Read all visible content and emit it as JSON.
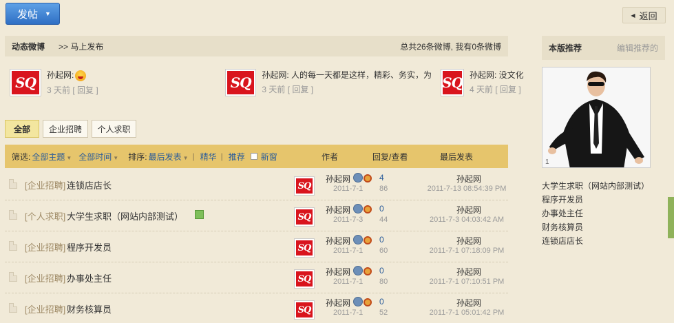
{
  "toolbar": {
    "post_label": "发帖",
    "back_label": "返回"
  },
  "weibo": {
    "title": "动态微博",
    "post_link": ">> 马上发布",
    "stats": "总共26条微博, 我有0条微博",
    "items": [
      {
        "text": "孙起网:",
        "meta_ago": "3 天前",
        "meta_reply": "[ 回复 ]"
      },
      {
        "text": "孙起网: 人的每一天都是这样，精彩、务实，为",
        "meta_ago": "3 天前",
        "meta_reply": "[ 回复 ]"
      },
      {
        "text": "孙起网: 没文化，真",
        "meta_ago": "4 天前",
        "meta_reply": "[ 回复 ]"
      }
    ],
    "logo_text": "SQ"
  },
  "filter_tabs": [
    {
      "label": "全部",
      "active": true
    },
    {
      "label": "企业招聘",
      "active": false
    },
    {
      "label": "个人求职",
      "active": false
    }
  ],
  "table_header": {
    "filter_label": "筛选:",
    "all_topics": "全部主题",
    "all_time": "全部时间",
    "sort_label": "排序:",
    "sort_value": "最后发表",
    "digest": "精华",
    "recommend": "推荐",
    "new_window": "新窗",
    "col_author": "作者",
    "col_replies": "回复/查看",
    "col_last": "最后发表"
  },
  "threads": [
    {
      "category": "[企业招聘]",
      "title": "连锁店店长",
      "has_image": false,
      "author": "孙起网",
      "date": "2011-7-1",
      "replies": "4",
      "views": "86",
      "last_user": "孙起网",
      "last_time": "2011-7-13 08:54:39 PM"
    },
    {
      "category": "[个人求职]",
      "title": "大学生求职（网站内部测试）",
      "has_image": true,
      "author": "孙起网",
      "date": "2011-7-3",
      "replies": "0",
      "views": "44",
      "last_user": "孙起网",
      "last_time": "2011-7-3 04:03:42 AM"
    },
    {
      "category": "[企业招聘]",
      "title": "程序开发员",
      "has_image": false,
      "author": "孙起网",
      "date": "2011-7-1",
      "replies": "0",
      "views": "60",
      "last_user": "孙起网",
      "last_time": "2011-7-1 07:18:09 PM"
    },
    {
      "category": "[企业招聘]",
      "title": "办事处主任",
      "has_image": false,
      "author": "孙起网",
      "date": "2011-7-1",
      "replies": "0",
      "views": "80",
      "last_user": "孙起网",
      "last_time": "2011-7-1 07:10:51 PM"
    },
    {
      "category": "[企业招聘]",
      "title": "财务核算员",
      "has_image": false,
      "author": "孙起网",
      "date": "2011-7-1",
      "replies": "0",
      "views": "52",
      "last_user": "孙起网",
      "last_time": "2011-7-1 05:01:42 PM"
    }
  ],
  "sidebar": {
    "title": "本版推荐",
    "edit_label": "编辑推荐的",
    "photo_index": "1",
    "links": [
      "大学生求职（网站内部测试）",
      "程序开发员",
      "办事处主任",
      "财务核算员",
      "连锁店店长"
    ]
  },
  "colors": {
    "accent_blue": "#2f6fc4",
    "header_gold": "#e6c56c",
    "bg": "#f1ead8",
    "logo_red": "#d9141d"
  }
}
